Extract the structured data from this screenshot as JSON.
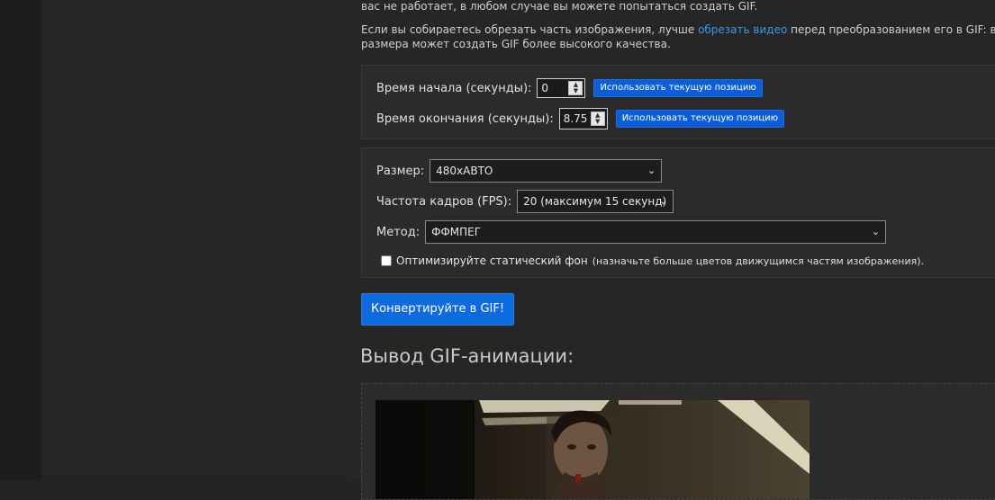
{
  "intro": {
    "line1": "вас не работает, в любом случае вы можете попытаться создать GIF.",
    "line2_before": "Если вы собираетесь обрезать часть изображения, лучше ",
    "line2_link": "обрезать видео",
    "line2_after": " перед преобразованием его в GIF: видео",
    "line3": "размера может создать GIF более высокого качества."
  },
  "trim": {
    "start_label": "Время начала (секунды):",
    "start_value": "0",
    "end_label": "Время окончания (секунды):",
    "end_value": "8.75",
    "use_position_label": "Использовать текущую позицию"
  },
  "options": {
    "size_label": "Размер:",
    "size_value": "480хАВТО",
    "fps_label": "Частота кадров (FPS):",
    "fps_value": "20 (максимум 15 секунд)",
    "method_label": "Метод:",
    "method_value": "ФФМПЕГ",
    "optimize_label": "Оптимизируйте статический фон",
    "optimize_hint": "(назначьте больше цветов движущимся частям изображения).",
    "optimize_checked": false
  },
  "convert_button": "Конвертируйте в GIF!",
  "output_title": "Вывод GIF-анимации:",
  "colors": {
    "accent": "#0d6adf",
    "link": "#3b99e8",
    "background": "#262626"
  }
}
